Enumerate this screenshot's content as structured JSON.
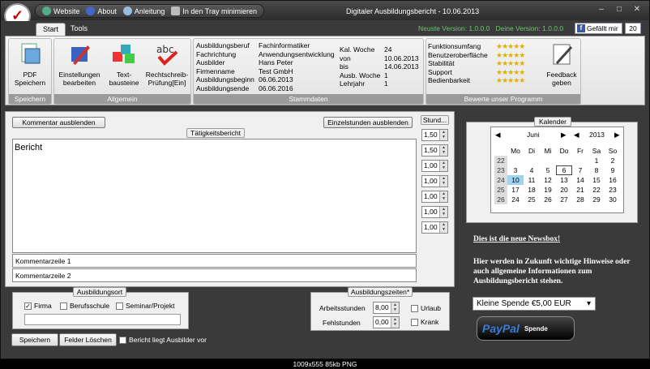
{
  "titlebar": {
    "title": "Digitaler Ausbildungsbericht - 10.06.2013",
    "quick": [
      "Website",
      "About",
      "Anleitung",
      "In den Tray minimieren"
    ]
  },
  "ribbon": {
    "tabs": [
      "Start",
      "Tools"
    ],
    "latest_version": "Neuste Version: 1.0.0.0",
    "your_version": "Deine Version: 1.0.0.0",
    "facebook_label": "Gefällt mir",
    "facebook_count": "20",
    "groups": {
      "speichern": {
        "label": "Speichern",
        "buttons": [
          "PDF Speichern"
        ]
      },
      "allgemein": {
        "label": "Allgemein",
        "buttons": [
          "Einstellungen bearbeiten",
          "Text-bausteine",
          "Rechtschreib-Prüfung[Ein]"
        ]
      },
      "stammdaten": {
        "label": "Stammdaten",
        "fields": [
          {
            "k": "Ausbildungsberuf",
            "v": "Fachinformatiker"
          },
          {
            "k": "Fachrichtung",
            "v": "Anwendungsentwicklung"
          },
          {
            "k": "Ausbilder",
            "v": "Hans Peter"
          },
          {
            "k": "Firmenname",
            "v": "Test GmbH"
          },
          {
            "k": "Ausbildungsbeginn",
            "v": "06.06.2013"
          },
          {
            "k": "Ausbildungsende",
            "v": "06.06.2016"
          }
        ],
        "week": [
          {
            "k": "Kal. Woche",
            "v": "24"
          },
          {
            "k": "von",
            "v": "10.06.2013"
          },
          {
            "k": "bis",
            "v": "14.06.2013"
          },
          {
            "k": "Ausb. Woche",
            "v": "1"
          },
          {
            "k": "Lehrjahr",
            "v": "1"
          }
        ]
      },
      "bewertung": {
        "label": "Bewerte unser Programm",
        "items": [
          "Funktionsumfang",
          "Benutzeroberfläche",
          "Stabilität",
          "Support",
          "Bedienbarkeit"
        ],
        "stars": "★★★★★",
        "feedback": "Feedback geben"
      }
    }
  },
  "report": {
    "hide_comment": "Kommentar ausblenden",
    "hide_hours": "Einzelstunden ausblenden",
    "heading": "Tätigkeitsbericht",
    "hours_heading": "Stund...",
    "body": "Bericht",
    "hours": [
      "1,50",
      "1,50",
      "1,00",
      "1,00",
      "1,00",
      "1,00",
      "1,00"
    ],
    "comments": [
      "Kommentarzeile 1",
      "Kommentarzeile 2"
    ]
  },
  "ausbildungsort": {
    "label": "Ausbildungsort",
    "options": [
      {
        "label": "Firma",
        "checked": true
      },
      {
        "label": "Berufsschule",
        "checked": false
      },
      {
        "label": "Seminar/Projekt",
        "checked": false
      }
    ]
  },
  "ausbildungszeiten": {
    "label": "Ausbildungszeiten*",
    "arbeitsstunden_label": "Arbeitsstunden",
    "arbeitsstunden": "8,00",
    "fehlstunden_label": "Fehlstunden",
    "fehlstunden": "0,00",
    "urlaub": "Urlaub",
    "krank": "Krank"
  },
  "actions": {
    "save": "Speichern",
    "clear": "Felder Löschen",
    "submitted": "Bericht liegt Ausbilder vor"
  },
  "calendar": {
    "label": "Kalender",
    "month": "Juni",
    "year": "2013",
    "days": [
      "Mo",
      "Di",
      "Mi",
      "Do",
      "Fr",
      "Sa",
      "So"
    ],
    "weeks": [
      {
        "wk": "22",
        "d": [
          "",
          "",
          "",
          "",
          "",
          "1",
          "2"
        ]
      },
      {
        "wk": "23",
        "d": [
          "3",
          "4",
          "5",
          "6",
          "7",
          "8",
          "9"
        ]
      },
      {
        "wk": "24",
        "d": [
          "10",
          "11",
          "12",
          "13",
          "14",
          "15",
          "16"
        ]
      },
      {
        "wk": "25",
        "d": [
          "17",
          "18",
          "19",
          "20",
          "21",
          "22",
          "23"
        ]
      },
      {
        "wk": "26",
        "d": [
          "24",
          "25",
          "26",
          "27",
          "28",
          "29",
          "30"
        ]
      }
    ],
    "today": "10",
    "selected": "6"
  },
  "news": {
    "link": "Dies ist die neue Newsbox!",
    "body": "Hier werden in Zukunft wichtige Hinweise oder auch allgemeine Informationen zum Ausbildungsbericht stehen."
  },
  "donation": {
    "selected": "Kleine Spende €5,00 EUR",
    "paypal": "PayPal",
    "paypal_sub": "Spende"
  },
  "footer": "1009x555 85kb PNG"
}
